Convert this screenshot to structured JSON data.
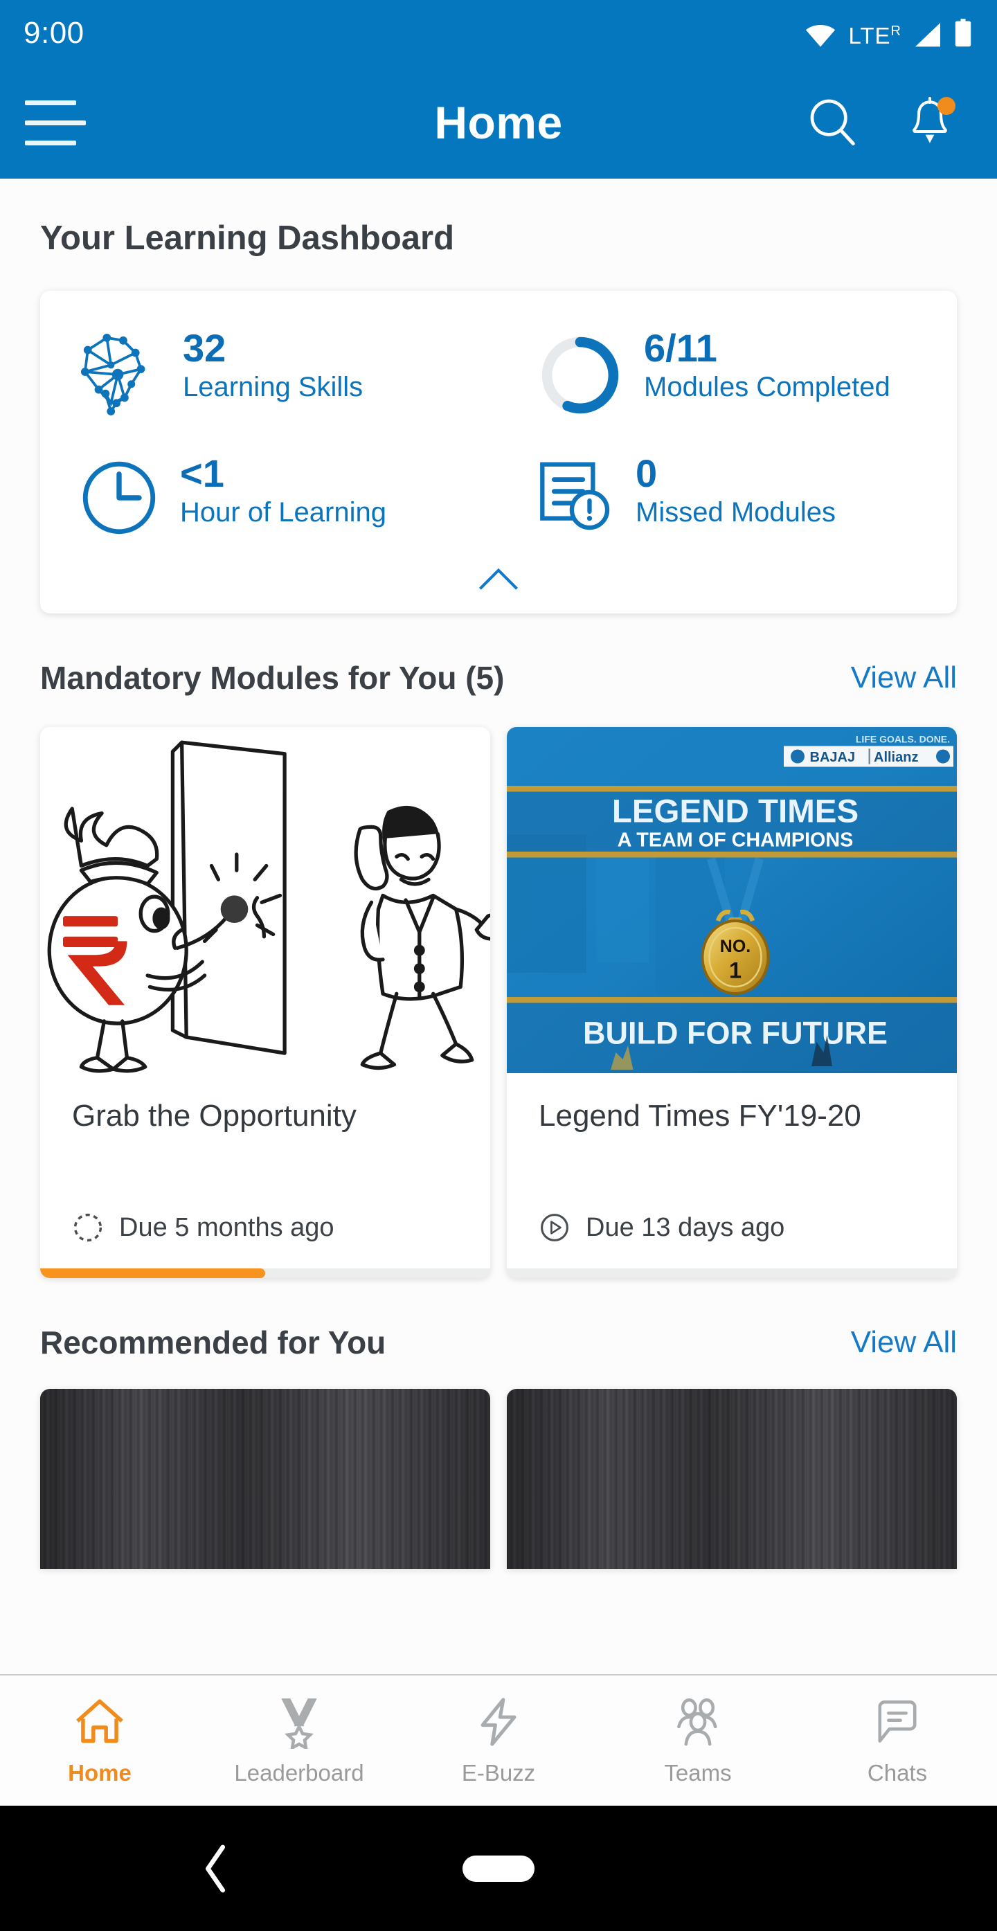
{
  "status_bar": {
    "time": "9:00",
    "network_label": "LTE",
    "roaming_indicator": "R",
    "icons": [
      "wifi-icon",
      "signal-icon",
      "battery-icon"
    ]
  },
  "app_bar": {
    "title": "Home",
    "menu_icon": "hamburger-menu-icon",
    "search_icon": "search-icon",
    "notifications_icon": "bell-icon",
    "has_notification_dot": true,
    "background_color": "#0477BE"
  },
  "dashboard": {
    "heading": "Your Learning Dashboard",
    "collapse_icon": "chevron-up-icon",
    "stats": [
      {
        "icon": "skills-network-icon",
        "value": "32",
        "label": "Learning Skills"
      },
      {
        "icon": "progress-ring-icon",
        "value": "6/11",
        "label": "Modules Completed",
        "progress_percent": 55
      },
      {
        "icon": "clock-icon",
        "value": "<1",
        "label": "Hour of Learning"
      },
      {
        "icon": "missed-document-icon",
        "value": "0",
        "label": "Missed Modules"
      }
    ]
  },
  "mandatory_section": {
    "title": "Mandatory Modules for You (5)",
    "view_all_label": "View All",
    "cards": [
      {
        "title": "Grab the Opportunity",
        "due_text": "Due 5 months ago",
        "due_icon": "dashed-circle-icon",
        "progress_percent": 50,
        "progress_color": "#F8931F",
        "thumbnail": "cartoon-money-bag-knocking-door"
      },
      {
        "title": "Legend Times FY'19-20",
        "due_text": "Due 13 days ago",
        "due_icon": "play-circle-icon",
        "progress_percent": 0,
        "thumbnail": "legend-times-poster",
        "poster": {
          "tagline": "LIFE GOALS. DONE.",
          "brand": "BAJAJ | Allianz",
          "headline": "LEGEND TIMES",
          "subhead": "A TEAM OF CHAMPIONS",
          "medal_top": "NO.",
          "medal_bottom": "1",
          "footer": "BUILD FOR FUTURE"
        }
      }
    ]
  },
  "recommended_section": {
    "title": "Recommended for You",
    "view_all_label": "View All",
    "cards": [
      {
        "thumbnail": "grey-wood-texture"
      },
      {
        "thumbnail": "grey-wood-texture"
      }
    ]
  },
  "bottom_nav": {
    "active_color": "#F08B1D",
    "inactive_color": "#9A9A9A",
    "items": [
      {
        "label": "Home",
        "icon": "home-icon",
        "active": true
      },
      {
        "label": "Leaderboard",
        "icon": "medal-icon",
        "active": false
      },
      {
        "label": "E-Buzz",
        "icon": "lightning-icon",
        "active": false
      },
      {
        "label": "Teams",
        "icon": "people-icon",
        "active": false
      },
      {
        "label": "Chats",
        "icon": "chat-bubble-icon",
        "active": false
      }
    ]
  },
  "android_nav": {
    "back_icon": "back-chevron-icon",
    "home_icon": "home-pill-icon"
  }
}
